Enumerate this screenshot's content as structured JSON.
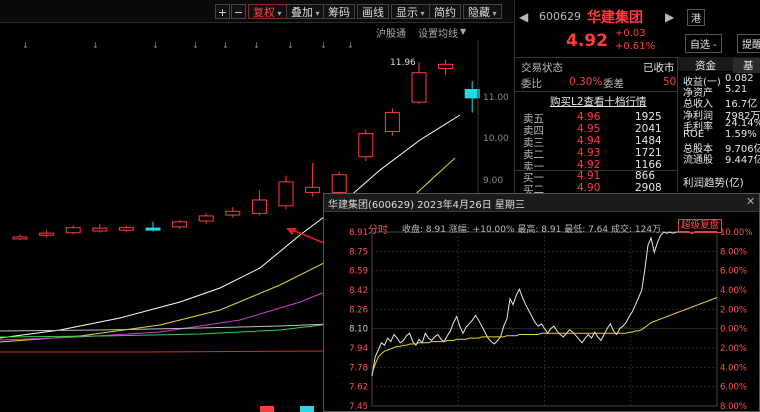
{
  "toolbar": {
    "items": [
      "+",
      "−",
      "复权",
      "叠加",
      "筹码",
      "画线",
      "显示",
      "简约",
      "隐藏"
    ],
    "active_index": 2
  },
  "subbar": {
    "exchange_label": "沪股通",
    "ma_label": "设置均线"
  },
  "kline": {
    "price_axis": [
      "11.00",
      "10.00",
      "9.00"
    ],
    "high_label": "11.96",
    "candles": [
      {
        "o": 7.72,
        "c": 7.74,
        "h": 7.8,
        "l": 7.66,
        "up": true
      },
      {
        "o": 7.78,
        "c": 7.83,
        "h": 7.9,
        "l": 7.73,
        "up": true
      },
      {
        "o": 7.84,
        "c": 7.96,
        "h": 8.02,
        "l": 7.8,
        "up": true
      },
      {
        "o": 7.95,
        "c": 7.88,
        "h": 8.05,
        "l": 7.84,
        "up": true
      },
      {
        "o": 7.9,
        "c": 7.96,
        "h": 8.0,
        "l": 7.86,
        "up": true
      },
      {
        "o": 7.93,
        "c": 7.95,
        "h": 8.1,
        "l": 7.87,
        "up": false
      },
      {
        "o": 7.98,
        "c": 8.1,
        "h": 8.14,
        "l": 7.94,
        "up": true
      },
      {
        "o": 8.12,
        "c": 8.24,
        "h": 8.3,
        "l": 8.05,
        "up": true
      },
      {
        "o": 8.26,
        "c": 8.35,
        "h": 8.45,
        "l": 8.2,
        "up": true
      },
      {
        "o": 8.3,
        "c": 8.62,
        "h": 8.85,
        "l": 8.25,
        "up": true
      },
      {
        "o": 8.48,
        "c": 9.05,
        "h": 9.2,
        "l": 8.4,
        "up": true
      },
      {
        "o": 8.92,
        "c": 8.8,
        "h": 9.5,
        "l": 8.7,
        "up": true
      },
      {
        "o": 8.8,
        "c": 9.22,
        "h": 9.3,
        "l": 8.68,
        "up": true
      },
      {
        "o": 9.65,
        "c": 10.2,
        "h": 10.3,
        "l": 9.55,
        "up": true
      },
      {
        "o": 10.25,
        "c": 10.7,
        "h": 10.8,
        "l": 10.15,
        "up": true
      },
      {
        "o": 10.95,
        "c": 11.65,
        "h": 11.9,
        "l": 10.9,
        "up": true
      },
      {
        "o": 11.75,
        "c": 11.85,
        "h": 11.96,
        "l": 11.6,
        "up": true
      },
      {
        "o": 11.25,
        "c": 11.05,
        "h": 11.45,
        "l": 10.7,
        "up": false
      }
    ]
  },
  "stock": {
    "code": "600629",
    "name": "华建集团",
    "exchange_tag": "港",
    "price": "4.92",
    "change": "+0.03",
    "change_pct": "+0.61%",
    "btn_watch": "自选 -",
    "btn_alert": "提醒"
  },
  "trade": {
    "status_label": "交易状态",
    "status_value": "已收市",
    "ratio_label": "委比",
    "ratio_value": "0.30%",
    "diff_label": "委差",
    "diff_value": "50",
    "l2_link": "购买L2查看十档行情",
    "asks": [
      {
        "label": "卖五",
        "price": "4.96",
        "vol": "1925"
      },
      {
        "label": "卖四",
        "price": "4.95",
        "vol": "2041"
      },
      {
        "label": "卖三",
        "price": "4.94",
        "vol": "1484"
      },
      {
        "label": "卖二",
        "price": "4.93",
        "vol": "1721"
      },
      {
        "label": "卖一",
        "price": "4.92",
        "vol": "1166"
      }
    ],
    "bids": [
      {
        "label": "买一",
        "price": "4.91",
        "vol": "866"
      },
      {
        "label": "买二",
        "price": "4.90",
        "vol": "2908"
      }
    ]
  },
  "finance": {
    "tab_fund": "资金",
    "tab_basic": "基",
    "rows": [
      {
        "label": "收益(一)",
        "value": "0.082"
      },
      {
        "label": "净资产",
        "value": "5.21"
      },
      {
        "label": "总收入",
        "value": "16.7亿"
      },
      {
        "label": "净利润",
        "value": "7982万"
      },
      {
        "label": "毛利率",
        "value": "24.14%"
      },
      {
        "label": "ROE",
        "value": "1.59%"
      },
      {
        "label": "总股本",
        "value": "9.706亿"
      },
      {
        "label": "流通股",
        "value": "9.447亿"
      }
    ],
    "trend_label": "利润趋势(亿)"
  },
  "popup": {
    "title": "华建集团(600629) 2023年4月26日 星期三",
    "tab": "分时",
    "stats": "收盘: 8.91  涨幅: +10.00%  最高: 8.91  最低: 7.64  成交: 124万",
    "badge": "超级复盘",
    "y_left": [
      "8.91",
      "8.75",
      "8.59",
      "8.42",
      "8.26",
      "8.10",
      "7.94",
      "7.78",
      "7.62",
      "7.45"
    ],
    "y_right": [
      "10.00%",
      "8.00%",
      "6.00%",
      "4.00%",
      "2.00%",
      "0.00%",
      "2.00%",
      "4.00%",
      "6.00%",
      "8.00%"
    ],
    "price_series": [
      7.7,
      7.86,
      7.92,
      7.98,
      7.96,
      8.02,
      7.99,
      8.05,
      8.02,
      7.98,
      8.0,
      8.04,
      8.06,
      7.99,
      7.96,
      8.01,
      7.98,
      8.06,
      8.02,
      8.0,
      8.03,
      8.05,
      8.01,
      7.99,
      8.04,
      8.08,
      8.15,
      8.2,
      8.12,
      8.06,
      8.11,
      8.14,
      8.17,
      8.21,
      8.17,
      8.12,
      8.07,
      8.02,
      7.99,
      7.97,
      8.0,
      8.03,
      8.12,
      8.18,
      8.35,
      8.3,
      8.38,
      8.43,
      8.36,
      8.3,
      8.25,
      8.2,
      8.15,
      8.12,
      8.14,
      8.1,
      8.06,
      8.1,
      8.12,
      8.08,
      8.05,
      8.03,
      8.06,
      8.09,
      8.07,
      8.04,
      8.01,
      7.98,
      8.02,
      8.05,
      8.02,
      8.07,
      8.03,
      8.0,
      8.05,
      8.1,
      8.14,
      8.08,
      8.05,
      8.1,
      8.12,
      8.15,
      8.2,
      8.24,
      8.3,
      8.36,
      8.42,
      8.6,
      8.8,
      8.86,
      8.74,
      8.82,
      8.88,
      8.91,
      8.9,
      8.91,
      8.9,
      8.91,
      8.91,
      8.91,
      8.91,
      8.91,
      8.9,
      8.91,
      8.91,
      8.91,
      8.91,
      8.91,
      8.91,
      8.91,
      8.91
    ],
    "avg_series": [
      7.72,
      7.8,
      7.86,
      7.89,
      7.91,
      7.92,
      7.93,
      7.94,
      7.95,
      7.95,
      7.96,
      7.96,
      7.97,
      7.97,
      7.97,
      7.98,
      7.98,
      7.98,
      7.98,
      7.99,
      7.99,
      7.99,
      7.99,
      7.99,
      8.0,
      8.0,
      8.0,
      8.01,
      8.01,
      8.01,
      8.01,
      8.02,
      8.02,
      8.02,
      8.02,
      8.03,
      8.03,
      8.03,
      8.03,
      8.03,
      8.03,
      8.03,
      8.03,
      8.04,
      8.04,
      8.04,
      8.04,
      8.05,
      8.05,
      8.05,
      8.05,
      8.05,
      8.05,
      8.05,
      8.06,
      8.06,
      8.06,
      8.06,
      8.06,
      8.06,
      8.06,
      8.06,
      8.06,
      8.06,
      8.06,
      8.06,
      8.06,
      8.06,
      8.06,
      8.06,
      8.06,
      8.06,
      8.06,
      8.06,
      8.06,
      8.06,
      8.06,
      8.06,
      8.06,
      8.06,
      8.06,
      8.06,
      8.07,
      8.07,
      8.08,
      8.08,
      8.09,
      8.11,
      8.13,
      8.15,
      8.16,
      8.17,
      8.18,
      8.19,
      8.2,
      8.21,
      8.22,
      8.23,
      8.24,
      8.25,
      8.26,
      8.27,
      8.28,
      8.29,
      8.3,
      8.31,
      8.32,
      8.33,
      8.34,
      8.35,
      8.36
    ]
  }
}
